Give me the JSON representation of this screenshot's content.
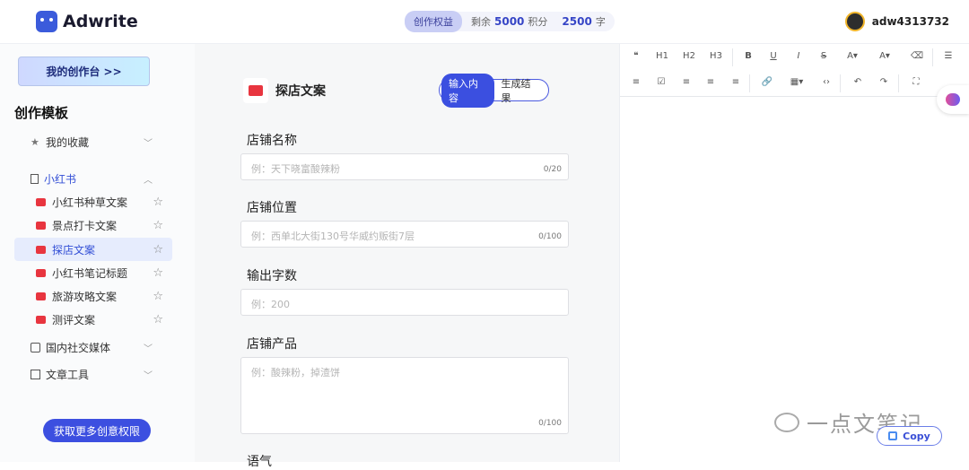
{
  "app": {
    "name": "Adwrite"
  },
  "header": {
    "credit_badge": "创作权益",
    "remaining_label": "剩余",
    "points_value": "5000",
    "points_unit": "积分",
    "chars_value": "2500",
    "chars_unit": "字",
    "username": "adw4313732"
  },
  "sidebar": {
    "workbench_label": "我的创作台 >>",
    "section_title": "创作模板",
    "favorites": "我的收藏",
    "xiaohongshu": "小红书",
    "sub_items": [
      {
        "label": "小红书种草文案"
      },
      {
        "label": "景点打卡文案"
      },
      {
        "label": "探店文案"
      },
      {
        "label": "小红书笔记标题"
      },
      {
        "label": "旅游攻略文案"
      },
      {
        "label": "测评文案"
      }
    ],
    "domestic_social": "国内社交媒体",
    "article_tools": "文章工具",
    "get_more_label": "获取更多创意权限"
  },
  "form": {
    "title": "探店文案",
    "tab_input": "输入内容",
    "tab_result": "生成结果",
    "fields": [
      {
        "label": "店铺名称",
        "placeholder": "例：天下晓富酸辣粉",
        "count": "0/20"
      },
      {
        "label": "店铺位置",
        "placeholder": "例：西单北大街130号华威约贩街7层",
        "count": "0/100"
      },
      {
        "label": "输出字数",
        "placeholder": "例：200",
        "count": ""
      },
      {
        "label": "店铺产品",
        "placeholder": "例：酸辣粉，掉渣饼",
        "count": "0/100"
      }
    ],
    "next_label": "语气"
  },
  "editor": {
    "toolbar_row1": [
      "❝",
      "H1",
      "H2",
      "H3",
      "B",
      "U",
      "I",
      "S",
      "A▾",
      "A▾",
      "⌫",
      "☰"
    ],
    "toolbar_row2": [
      "≡",
      "☑",
      "≡",
      "≡",
      "≡",
      "🔗",
      "▦▾",
      "‹›",
      "↶",
      "↷",
      "⛶"
    ],
    "copy_label": "Copy",
    "watermark": "一点文笔记"
  }
}
